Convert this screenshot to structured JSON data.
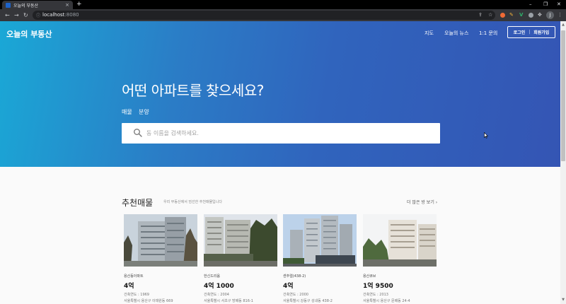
{
  "browser": {
    "tab_title": "오늘의 부동산",
    "tab_close": "×",
    "new_tab": "+",
    "url_host": "localhost",
    "url_port": ":8080",
    "profile_initial": "J",
    "window_controls": [
      "–",
      "❐",
      "✕"
    ]
  },
  "site": {
    "logo": "오늘의 부동산",
    "nav": [
      "지도",
      "오늘의 뉴스",
      "1:1 문의"
    ],
    "login": "로그인",
    "auth_separator": "|",
    "signup": "회원가입"
  },
  "hero": {
    "headline": "어떤 아파트를 찾으세요?",
    "tabs": [
      "매물",
      "분양"
    ],
    "search_placeholder": "동 이름을 검색하세요."
  },
  "recommended": {
    "title": "추천매물",
    "subtitle": "우리 부동산에서 엄선한 추천매물입니다",
    "more": "더 많은 방 보기 ›",
    "cards": [
      {
        "name": "용산동아파트",
        "price": "4억",
        "year": "건축연도 : 1969",
        "address": "서울특별시 용산구 이태원동 669"
      },
      {
        "name": "한신드리움",
        "price": "4억 1000",
        "year": "건축연도 : 2004",
        "address": "서울특별시 서초구 방배동 816-1"
      },
      {
        "name": "센추럴(438-2)",
        "price": "4억",
        "year": "건축연도 : 2000",
        "address": "서울특별시 강동구 성내동 438-2"
      },
      {
        "name": "용산큐브",
        "price": "1억 9500",
        "year": "건축연도 : 2013",
        "address": "서울특별시 용산구 문배동 24-4"
      }
    ]
  },
  "colors": {
    "hero_start": "#1aa8d6",
    "hero_end": "#3455b4",
    "chrome_dark": "#35363a"
  }
}
